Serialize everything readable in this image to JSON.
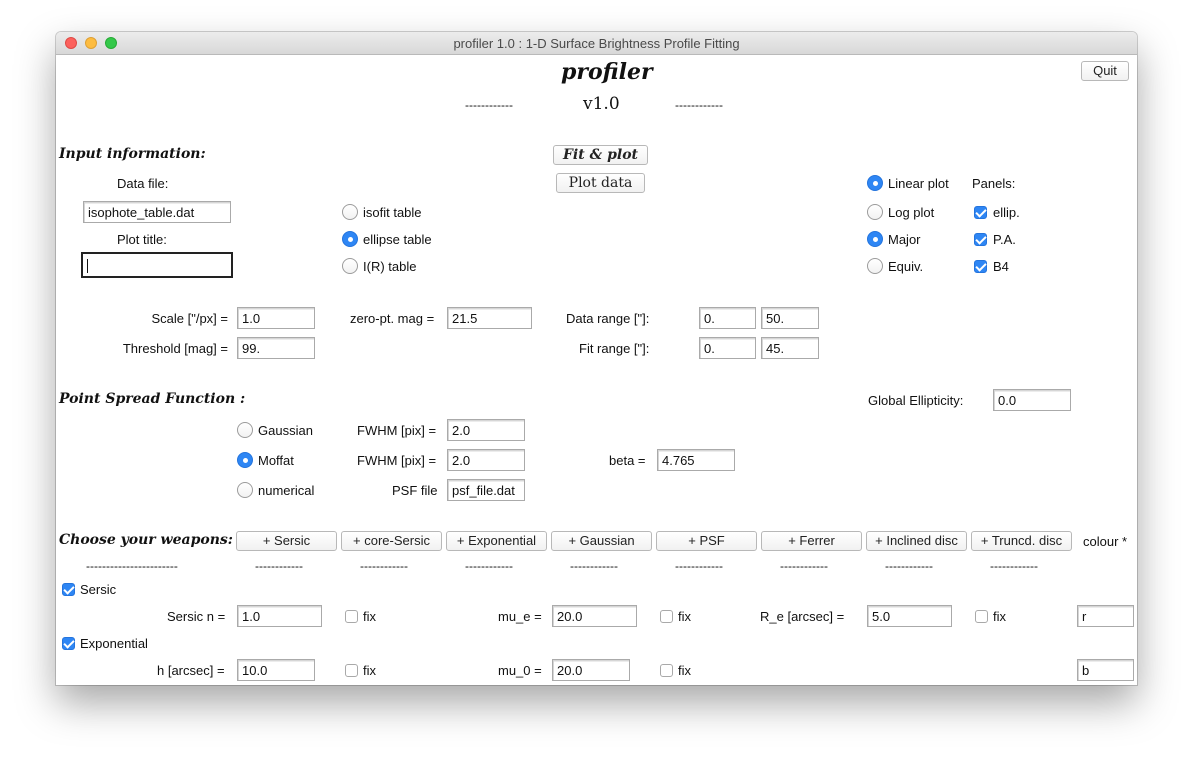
{
  "window": {
    "title": "profiler 1.0 : 1-D Surface Brightness Profile Fitting"
  },
  "app": {
    "name": "profiler",
    "version": "v1.0",
    "dashes": "------------",
    "quit_label": "Quit"
  },
  "input": {
    "heading": "Input information:",
    "fit_plot_label": "Fit & plot",
    "plot_data_label": "Plot data",
    "data_file_label": "Data file:",
    "data_file_value": "isophote_table.dat",
    "plot_title_label": "Plot title:",
    "plot_title_value": "",
    "table_types": [
      {
        "label": "isofit table",
        "selected": false
      },
      {
        "label": "ellipse table",
        "selected": true
      },
      {
        "label": "I(R) table",
        "selected": false
      }
    ],
    "plot_scale": [
      {
        "label": "Linear plot",
        "selected": true
      },
      {
        "label": "Log plot",
        "selected": false
      }
    ],
    "axis_type": [
      {
        "label": "Major",
        "selected": true
      },
      {
        "label": "Equiv.",
        "selected": false
      }
    ],
    "panels_label": "Panels:",
    "panels": [
      {
        "label": "ellip.",
        "checked": true
      },
      {
        "label": "P.A.",
        "checked": true
      },
      {
        "label": "B4",
        "checked": true
      }
    ],
    "scale_label": "Scale [\"/px] =",
    "scale_value": "1.0",
    "zeropt_label": "zero-pt. mag =",
    "zeropt_value": "21.5",
    "threshold_label": "Threshold [mag] =",
    "threshold_value": "99.",
    "data_range_label": "Data range [\"]:",
    "data_range_min": "0.",
    "data_range_max": "50.",
    "fit_range_label": "Fit range [\"]:",
    "fit_range_min": "0.",
    "fit_range_max": "45."
  },
  "psf": {
    "heading": "Point Spread Function :",
    "global_ellipticity_label": "Global Ellipticity:",
    "global_ellipticity_value": "0.0",
    "types": [
      {
        "label": "Gaussian",
        "selected": false
      },
      {
        "label": "Moffat",
        "selected": true
      },
      {
        "label": "numerical",
        "selected": false
      }
    ],
    "fwhm_label": "FWHM [pix] =",
    "gaussian_fwhm": "2.0",
    "moffat_fwhm": "2.0",
    "beta_label": "beta =",
    "beta_value": "4.765",
    "psf_file_label": "PSF file",
    "psf_file_value": "psf_file.dat"
  },
  "weapons": {
    "heading": "Choose your weapons:",
    "buttons": [
      "+ Sersic",
      "+ core-Sersic",
      "+ Exponential",
      "+ Gaussian",
      "+ PSF",
      "+ Ferrer",
      "+ Inclined disc",
      "+ Truncd. disc"
    ],
    "colour_label": "colour *",
    "heading_dashes": "-----------------------",
    "button_dashes": "------------"
  },
  "components": {
    "fix_label": "fix",
    "sersic": {
      "label": "Sersic",
      "checked": true,
      "n_label": "Sersic n =",
      "n_value": "1.0",
      "mue_label": "mu_e =",
      "mue_value": "20.0",
      "re_label": "R_e [arcsec] =",
      "re_value": "5.0",
      "colour": "r"
    },
    "exponential": {
      "label": "Exponential",
      "checked": true,
      "h_label": "h [arcsec] =",
      "h_value": "10.0",
      "mu0_label": "mu_0 =",
      "mu0_value": "20.0",
      "colour": "b"
    }
  }
}
